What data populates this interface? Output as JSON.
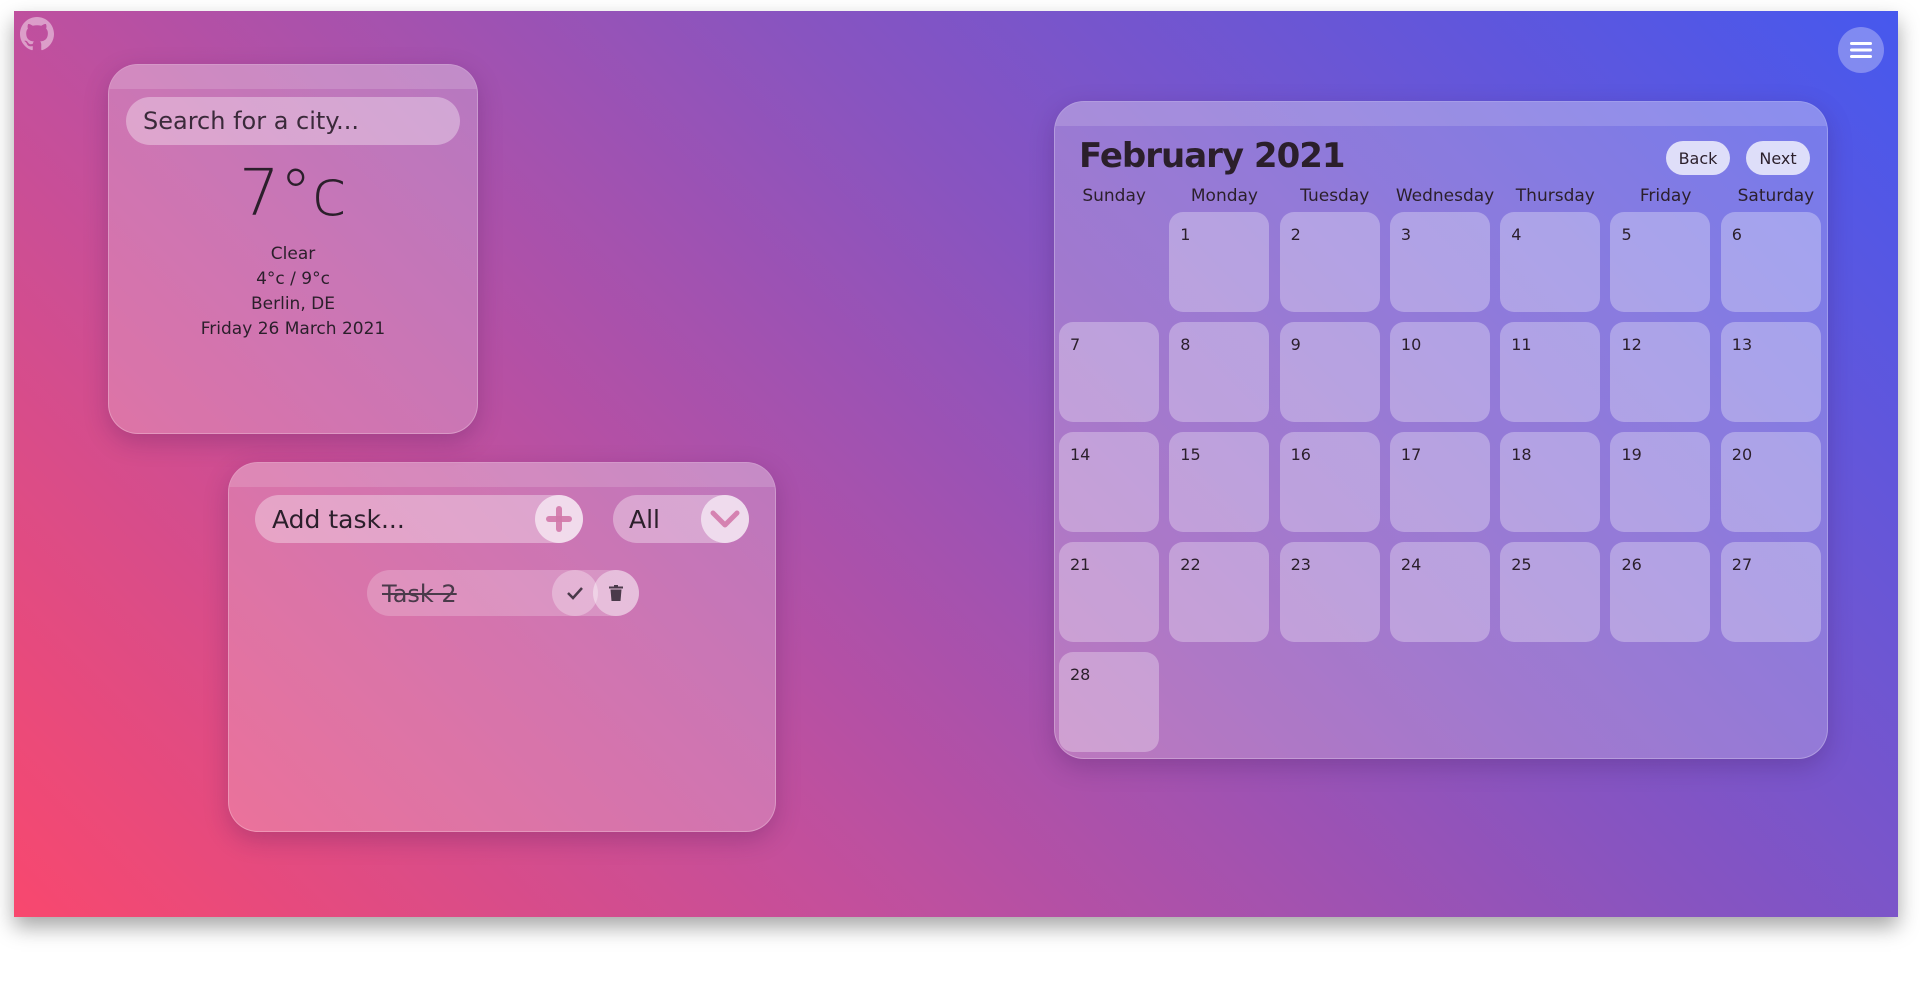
{
  "weather": {
    "search_placeholder": "Search for a city...",
    "temperature": "7°c",
    "condition": "Clear",
    "range": "4°c / 9°c",
    "location": "Berlin, DE",
    "date": "Friday 26 March 2021"
  },
  "todo": {
    "input_placeholder": "Add task...",
    "filter_value": "All",
    "tasks": [
      {
        "label": "Task 2",
        "completed": true
      }
    ]
  },
  "calendar": {
    "title": "February 2021",
    "back_label": "Back",
    "next_label": "Next",
    "weekdays": [
      "Sunday",
      "Monday",
      "Tuesday",
      "Wednesday",
      "Thursday",
      "Friday",
      "Saturday"
    ],
    "days": [
      "",
      "1",
      "2",
      "3",
      "4",
      "5",
      "6",
      "7",
      "8",
      "9",
      "10",
      "11",
      "12",
      "13",
      "14",
      "15",
      "16",
      "17",
      "18",
      "19",
      "20",
      "21",
      "22",
      "23",
      "24",
      "25",
      "26",
      "27",
      "28"
    ]
  },
  "icons": {
    "github": "github-icon",
    "menu": "hamburger-menu-icon",
    "add": "plus-icon",
    "filter": "chevron-down-icon",
    "complete": "check-icon",
    "delete": "trash-icon"
  }
}
